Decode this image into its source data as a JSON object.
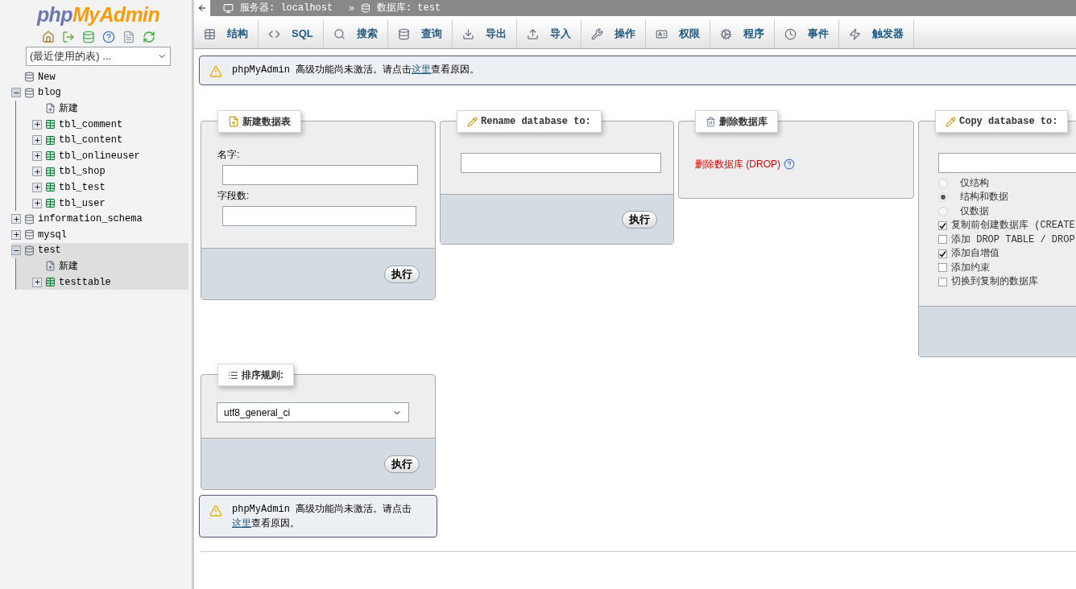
{
  "sidebar": {
    "logo": {
      "part1": "php",
      "part2": "MyAdmin"
    },
    "recent_tables": "(最近使用的表) ...",
    "tree": [
      {
        "label": "New",
        "kind": "new",
        "selected": false
      },
      {
        "label": "blog",
        "kind": "database",
        "expanded": true,
        "selected": false,
        "children": [
          {
            "label": "新建",
            "kind": "new_table",
            "selected": false
          },
          {
            "label": "tbl_comment",
            "kind": "table",
            "expanded": false,
            "selected": false
          },
          {
            "label": "tbl_content",
            "kind": "table",
            "expanded": false,
            "selected": false
          },
          {
            "label": "tbl_onlineuser",
            "kind": "table",
            "expanded": false,
            "selected": false
          },
          {
            "label": "tbl_shop",
            "kind": "table",
            "expanded": false,
            "selected": false
          },
          {
            "label": "tbl_test",
            "kind": "table",
            "expanded": false,
            "selected": false
          },
          {
            "label": "tbl_user",
            "kind": "table",
            "expanded": false,
            "selected": false
          }
        ]
      },
      {
        "label": "information_schema",
        "kind": "database",
        "expanded": false,
        "selected": false
      },
      {
        "label": "mysql",
        "kind": "database",
        "expanded": false,
        "selected": false
      },
      {
        "label": "test",
        "kind": "database",
        "expanded": true,
        "selected": true,
        "children": [
          {
            "label": "新建",
            "kind": "new_table",
            "selected": false
          },
          {
            "label": "testtable",
            "kind": "table",
            "expanded": false,
            "selected": false
          }
        ]
      }
    ]
  },
  "breadcrumb": {
    "server": "服务器: localhost",
    "separator": "»",
    "database": "数据库: test"
  },
  "tabs": [
    {
      "label": "结构",
      "kind": "structure",
      "selected": false
    },
    {
      "label": "SQL",
      "kind": "sql",
      "selected": false
    },
    {
      "label": "搜索",
      "kind": "search",
      "selected": false
    },
    {
      "label": "查询",
      "kind": "query",
      "selected": false
    },
    {
      "label": "导出",
      "kind": "export",
      "selected": false
    },
    {
      "label": "导入",
      "kind": "import",
      "selected": false
    },
    {
      "label": "操作",
      "kind": "operations",
      "selected": false
    },
    {
      "label": "权限",
      "kind": "privileges",
      "selected": false
    },
    {
      "label": "程序",
      "kind": "routines",
      "selected": false
    },
    {
      "label": "事件",
      "kind": "events",
      "selected": false
    },
    {
      "label": "触发器",
      "kind": "triggers",
      "selected": false
    }
  ],
  "notice": {
    "before": "phpMyAdmin 高级功能尚未激活。请点击",
    "link": "这里",
    "after": "查看原因。"
  },
  "create_table": {
    "title": "新建数据表",
    "name_label": "名字:",
    "fields_label": "字段数:",
    "button": "执行"
  },
  "rename": {
    "title": "Rename database to:",
    "button": "执行"
  },
  "drop": {
    "title": "删除数据库",
    "link": "删除数据库 (DROP)"
  },
  "copy": {
    "title": "Copy database to:",
    "options": [
      {
        "label": "仅结构",
        "kind": "radio",
        "checked": false
      },
      {
        "label": "结构和数据",
        "kind": "radio",
        "checked": true
      },
      {
        "label": "仅数据",
        "kind": "radio",
        "checked": false
      },
      {
        "label": "复制前创建数据库 (CREATE",
        "kind": "checkbox",
        "checked": true
      },
      {
        "label": "添加 DROP TABLE / DROP",
        "kind": "checkbox",
        "checked": false
      },
      {
        "label": "添加自增值",
        "kind": "checkbox",
        "checked": true
      },
      {
        "label": "添加约束",
        "kind": "checkbox",
        "checked": false
      },
      {
        "label": "切换到复制的数据库",
        "kind": "checkbox",
        "checked": false
      }
    ]
  },
  "collation": {
    "title": "排序规则:",
    "value": "utf8_general_ci",
    "button": "执行"
  },
  "notice_bottom": {
    "before": "phpMyAdmin 高级功能尚未激活。请点击",
    "link": "这里",
    "after": "查看原因。"
  }
}
